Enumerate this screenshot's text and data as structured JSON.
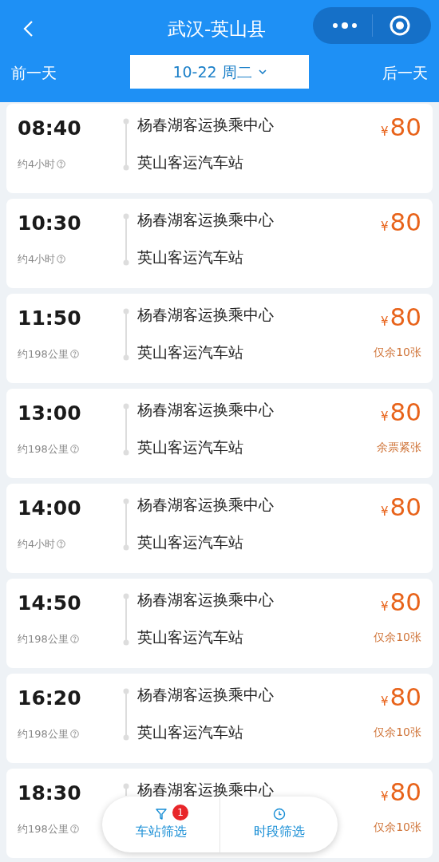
{
  "header": {
    "title": "武汉-英山县",
    "prev_day": "前一天",
    "date": "10-22 周二",
    "next_day": "后一天"
  },
  "trips": [
    {
      "time": "08:40",
      "info": "约4小时",
      "from": "杨春湖客运换乘中心",
      "to": "英山客运汽车站",
      "currency": "¥",
      "price": "80"
    },
    {
      "time": "10:30",
      "info": "约4小时",
      "from": "杨春湖客运换乘中心",
      "to": "英山客运汽车站",
      "currency": "¥",
      "price": "80"
    },
    {
      "time": "11:50",
      "info": "约198公里",
      "from": "杨春湖客运换乘中心",
      "to": "英山客运汽车站",
      "currency": "¥",
      "price": "80",
      "note": "仅余10张"
    },
    {
      "time": "13:00",
      "info": "约198公里",
      "from": "杨春湖客运换乘中心",
      "to": "英山客运汽车站",
      "currency": "¥",
      "price": "80",
      "note": "余票紧张"
    },
    {
      "time": "14:00",
      "info": "约4小时",
      "from": "杨春湖客运换乘中心",
      "to": "英山客运汽车站",
      "currency": "¥",
      "price": "80"
    },
    {
      "time": "14:50",
      "info": "约198公里",
      "from": "杨春湖客运换乘中心",
      "to": "英山客运汽车站",
      "currency": "¥",
      "price": "80",
      "note": "仅余10张"
    },
    {
      "time": "16:20",
      "info": "约198公里",
      "from": "杨春湖客运换乘中心",
      "to": "英山客运汽车站",
      "currency": "¥",
      "price": "80",
      "note": "仅余10张"
    },
    {
      "time": "18:30",
      "info": "约198公里",
      "from": "杨春湖客运换乘中心",
      "currency": "¥",
      "price": "80",
      "note": "仅余10张"
    }
  ],
  "filters": [
    {
      "kind": "station",
      "label": "车站筛选",
      "badge": "1"
    },
    {
      "kind": "time",
      "label": "时段筛选"
    }
  ]
}
